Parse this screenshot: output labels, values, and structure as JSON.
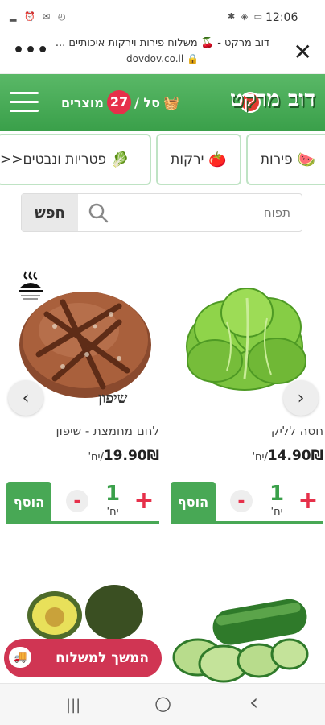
{
  "status_bar": {
    "time": "12:06",
    "left_icons": [
      "sim-icon",
      "alarm-icon"
    ],
    "right_icons": [
      "bluetooth-icon",
      "wifi-icon",
      "battery-icon"
    ]
  },
  "browser": {
    "title": "דוב מרקט - 🍒 משלוח פירות וירקות איכותיים ...",
    "url": "dovdov.co.il",
    "menu_glyph": "•••",
    "close_glyph": "✕"
  },
  "header": {
    "logo_text": "דוב מרקט",
    "cart_prefix": "סל /",
    "cart_count": "27",
    "cart_suffix": "מוצרים",
    "basket_glyph": "🧺"
  },
  "categories": [
    {
      "label": "פירות",
      "emoji": "🍉"
    },
    {
      "label": "ירקות",
      "emoji": "🍅"
    },
    {
      "label": "פטריות ונבטים",
      "emoji": "🥬",
      "more": "<<"
    }
  ],
  "search": {
    "placeholder": "תפוח",
    "button_label": "חפש"
  },
  "products": [
    {
      "name": "חסה לליק",
      "price": "14.90₪",
      "unit": "/יח'",
      "qty": "1",
      "qty_unit": "יח'",
      "add_label": "הוסף",
      "minus": "-",
      "plus": "+"
    },
    {
      "name": "לחם מחמצת - שיפון",
      "price": "19.90₪",
      "unit": "/יח'",
      "qty": "1",
      "qty_unit": "יח'",
      "add_label": "הוסף",
      "minus": "-",
      "plus": "+",
      "image_label": "שיפון"
    }
  ],
  "carousel": {
    "prev_glyph": "‹",
    "next_glyph": "›"
  },
  "continue_button": {
    "label": "המשך למשלוח",
    "icon_glyph": "🚚"
  },
  "navbar": {
    "recent_glyph": "|||",
    "home_glyph": "○",
    "back_glyph": "‹"
  },
  "colors": {
    "brand_green": "#48a855",
    "accent_red": "#d03553",
    "badge_red": "#e6304a"
  }
}
